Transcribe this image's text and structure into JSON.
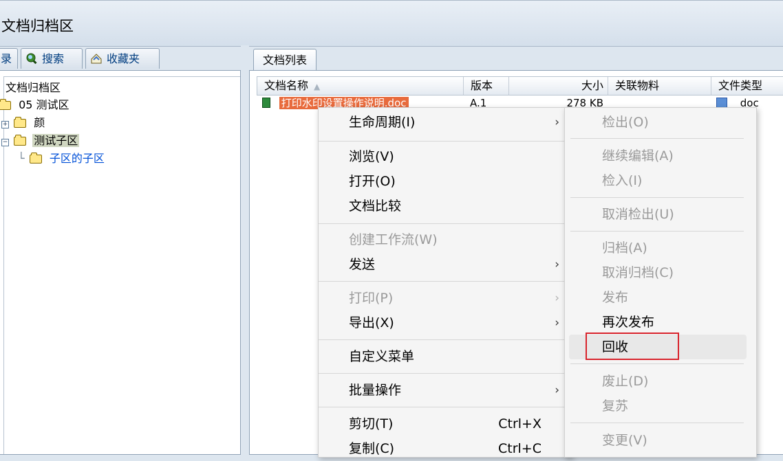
{
  "app": {
    "title": "文档归档区"
  },
  "left_tabs": [
    {
      "label": "录",
      "icon": "directory-icon"
    },
    {
      "label": "搜索",
      "icon": "search-icon"
    },
    {
      "label": "收藏夹",
      "icon": "favorites-icon"
    }
  ],
  "tree": {
    "root": "文档归档区",
    "n1": "05 测试区",
    "n2": "颜",
    "n3": "测试子区",
    "n4": "子区的子区"
  },
  "right_tab": "文档列表",
  "grid": {
    "columns": [
      "文档名称",
      "版本",
      "大小",
      "关联物料",
      "文件类型"
    ],
    "rows": [
      {
        "name": "打印水印设置操作说明.doc",
        "version": "A.1",
        "size": "278 KB",
        "material": "",
        "type": "doc"
      }
    ]
  },
  "menu": {
    "lifecycle": "生命周期(I)",
    "browse": "浏览(V)",
    "open": "打开(O)",
    "compare": "文档比较",
    "create_wf": "创建工作流(W)",
    "send": "发送",
    "print": "打印(P)",
    "export": "导出(X)",
    "custom": "自定义菜单",
    "batch": "批量操作",
    "cut": "剪切(T)",
    "cut_sc": "Ctrl+X",
    "copy": "复制(C)",
    "copy_sc": "Ctrl+C",
    "arrow": "›"
  },
  "submenu": {
    "checkout": "检出(O)",
    "continue_edit": "继续编辑(A)",
    "checkin": "检入(I)",
    "cancel_checkout": "取消检出(U)",
    "archive": "归档(A)",
    "cancel_archive": "取消归档(C)",
    "publish": "发布",
    "republish": "再次发布",
    "recall": "回收",
    "obsolete": "废止(D)",
    "revive": "复苏",
    "change": "变更(V)"
  },
  "colors": {
    "highlight": "#e86b3d",
    "redbox": "#d8222b"
  }
}
